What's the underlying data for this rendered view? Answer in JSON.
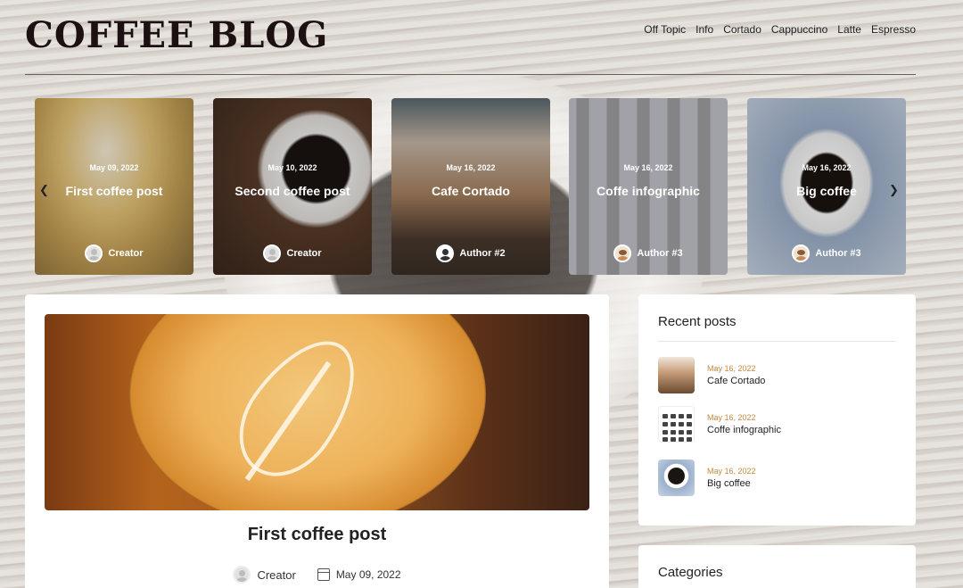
{
  "header": {
    "logo": "COFFEE BLOG",
    "nav": [
      "Off Topic",
      "Info",
      "Cortado",
      "Cappuccino",
      "Latte",
      "Espresso"
    ]
  },
  "carousel": {
    "cards": [
      {
        "date": "May 09, 2022",
        "title": "First coffee post",
        "author": "Creator",
        "avatar": "default-avatar-icon",
        "bg": "#c8a257"
      },
      {
        "date": "May 10, 2022",
        "title": "Second coffee post",
        "author": "Creator",
        "avatar": "default-avatar-icon",
        "bg": "#4a3326"
      },
      {
        "date": "May 16, 2022",
        "title": "Cafe Cortado",
        "author": "Author #2",
        "avatar": "dark-avatar-icon",
        "bg": "#7b6656"
      },
      {
        "date": "May 16, 2022",
        "title": "Coffe infographic",
        "author": "Author #3",
        "avatar": "coffee-cup-avatar-icon",
        "bg": "#9c9fa6"
      },
      {
        "date": "May 16, 2022",
        "title": "Big coffee",
        "author": "Author #3",
        "avatar": "coffee-cup-avatar-icon",
        "bg": "#8ea3bf"
      }
    ],
    "prev_icon": "chevron-left-icon",
    "next_icon": "chevron-right-icon"
  },
  "post": {
    "title": "First coffee post",
    "author": "Creator",
    "date": "May 09, 2022"
  },
  "sidebar": {
    "recent_title": "Recent posts",
    "recent": [
      {
        "date": "May 16, 2022",
        "title": "Cafe Cortado"
      },
      {
        "date": "May 16, 2022",
        "title": "Coffe infographic"
      },
      {
        "date": "May 16, 2022",
        "title": "Big coffee"
      }
    ],
    "categories_title": "Categories"
  },
  "colors": {
    "accent_date": "#c4873e",
    "logo": "#1c1110"
  }
}
